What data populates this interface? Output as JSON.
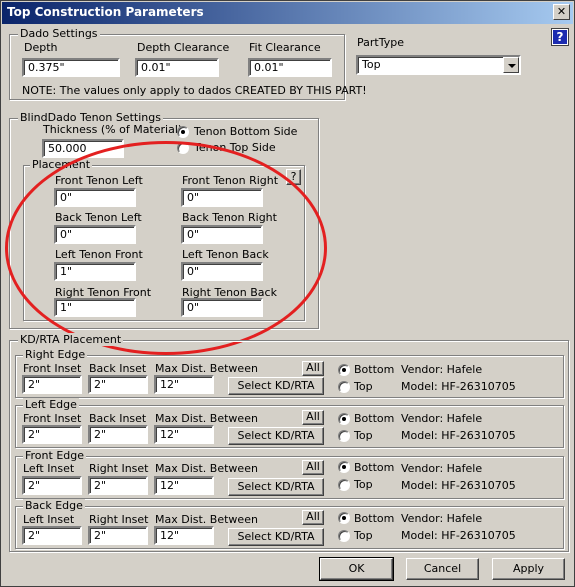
{
  "window": {
    "title": "Top Construction Parameters"
  },
  "dado": {
    "legend": "Dado Settings",
    "depth_label": "Depth",
    "depth_value": "0.375\"",
    "clearance_label": "Depth Clearance",
    "clearance_value": "0.01\"",
    "fit_label": "Fit Clearance",
    "fit_value": "0.01\"",
    "note": "NOTE: The values only apply to dados CREATED BY THIS PART!"
  },
  "part_type": {
    "label": "PartType",
    "value": "Top"
  },
  "help": {
    "glyph": "?"
  },
  "blind": {
    "legend": "BlindDado Tenon Settings",
    "thickness_label": "Thickness (% of Material)",
    "thickness_value": "50.000",
    "bottom_label": "Tenon Bottom Side",
    "top_label": "Tenon Top Side",
    "bottom_selected": true
  },
  "placement": {
    "legend": "Placement",
    "help_glyph": "?",
    "fields": [
      {
        "label": "Front Tenon Left",
        "value": "0\""
      },
      {
        "label": "Front Tenon Right",
        "value": "0\""
      },
      {
        "label": "Back Tenon Left",
        "value": "0\""
      },
      {
        "label": "Back Tenon Right",
        "value": "0\""
      },
      {
        "label": "Left Tenon Front",
        "value": "1\""
      },
      {
        "label": "Left Tenon Back",
        "value": "0\""
      },
      {
        "label": "Right Tenon Front",
        "value": "1\""
      },
      {
        "label": "Right Tenon Back",
        "value": "0\""
      }
    ]
  },
  "kd": {
    "legend": "KD/RTA Placement",
    "edges": [
      {
        "name": "Right Edge",
        "l1": "Front Inset",
        "v1": "2\"",
        "l2": "Back Inset",
        "v2": "2\"",
        "l3": "Max Dist. Between",
        "v3": "12\"",
        "all": "All",
        "select": "Select KD/RTA",
        "bottom": "Bottom",
        "top": "Top",
        "vendor": "Vendor: Hafele",
        "model": "Model: HF-26310705"
      },
      {
        "name": "Left Edge",
        "l1": "Front Inset",
        "v1": "2\"",
        "l2": "Back Inset",
        "v2": "2\"",
        "l3": "Max Dist. Between",
        "v3": "12\"",
        "all": "All",
        "select": "Select KD/RTA",
        "bottom": "Bottom",
        "top": "Top",
        "vendor": "Vendor: Hafele",
        "model": "Model: HF-26310705"
      },
      {
        "name": "Front Edge",
        "l1": "Left Inset",
        "v1": "2\"",
        "l2": "Right Inset",
        "v2": "2\"",
        "l3": "Max Dist. Between",
        "v3": "12\"",
        "all": "All",
        "select": "Select KD/RTA",
        "bottom": "Bottom",
        "top": "Top",
        "vendor": "Vendor: Hafele",
        "model": "Model: HF-26310705"
      },
      {
        "name": "Back Edge",
        "l1": "Left Inset",
        "v1": "2\"",
        "l2": "Right Inset",
        "v2": "2\"",
        "l3": "Max Dist. Between",
        "v3": "12\"",
        "all": "All",
        "select": "Select KD/RTA",
        "bottom": "Bottom",
        "top": "Top",
        "vendor": "Vendor: Hafele",
        "model": "Model: HF-26310705"
      }
    ]
  },
  "buttons": {
    "ok": "OK",
    "cancel": "Cancel",
    "apply": "Apply"
  },
  "colors": {
    "title_bar": "#0a246a",
    "annotation": "#e32020",
    "face": "#d4d0c8"
  }
}
